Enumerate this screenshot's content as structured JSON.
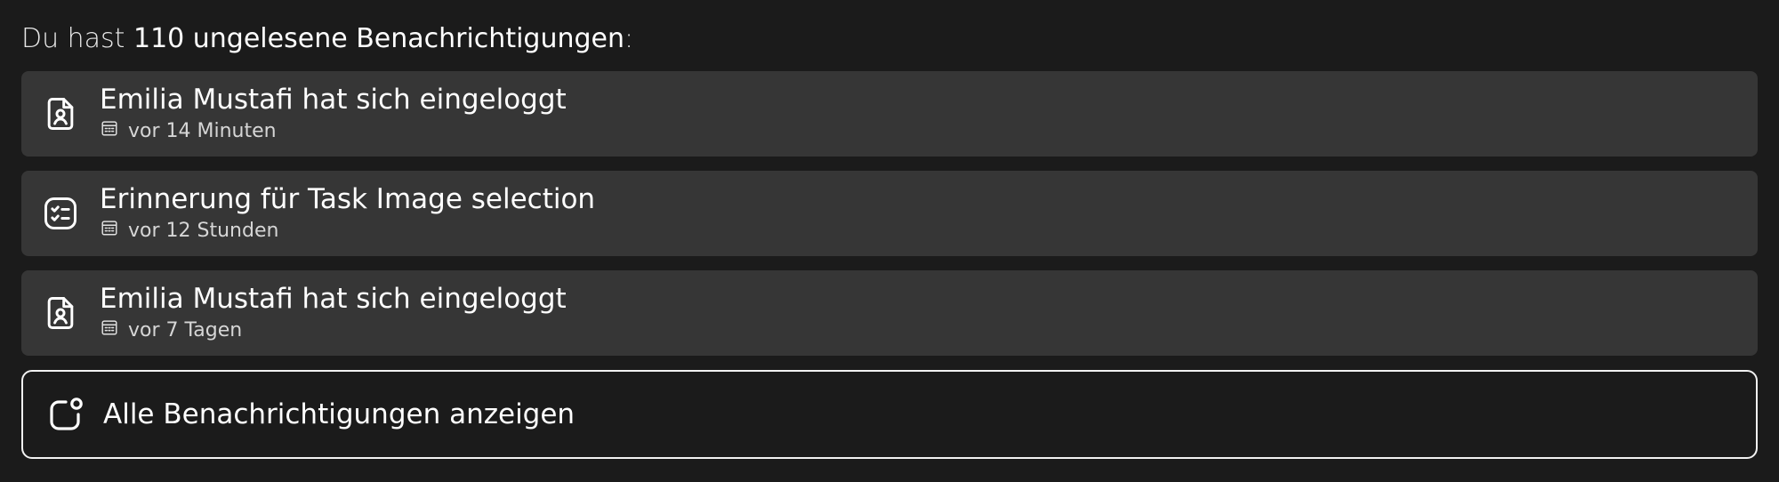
{
  "summary": {
    "prefix": "Du hast ",
    "count": "110 ungelesene Benachrichtigungen",
    "suffix": ":"
  },
  "notifications": [
    {
      "icon": "user-document-icon",
      "title": "Emilia Mustafi hat sich eingeloggt",
      "time": "vor 14 Minuten"
    },
    {
      "icon": "checklist-icon",
      "title": "Erinnerung für Task Image selection",
      "time": "vor 12 Stunden"
    },
    {
      "icon": "user-document-icon",
      "title": "Emilia Mustafi hat sich eingeloggt",
      "time": "vor 7 Tagen"
    }
  ],
  "show_all": {
    "icon": "notification-badge-icon",
    "label": "Alle Benachrichtigungen anzeigen"
  },
  "colors": {
    "background": "#1b1b1b",
    "card": "#363636",
    "text": "#ffffff",
    "border": "#f2f2f2"
  }
}
